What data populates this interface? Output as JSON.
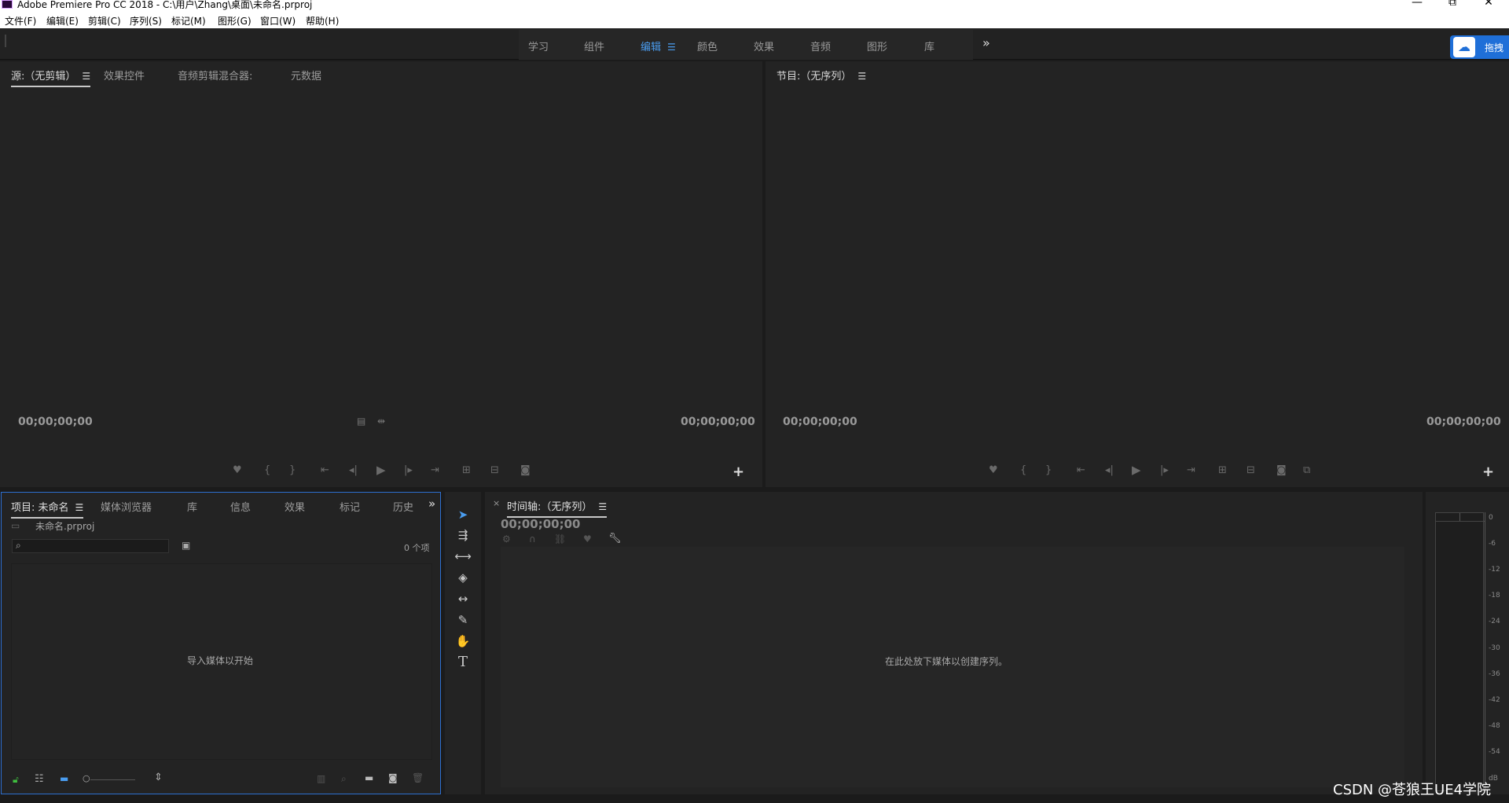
{
  "window": {
    "title": "Adobe Premiere Pro CC 2018 - C:\\用户\\Zhang\\桌面\\未命名.prproj",
    "minimize": "—",
    "maximize": "⧉",
    "close": "✕"
  },
  "menu": [
    "文件(F)",
    "编辑(E)",
    "剪辑(C)",
    "序列(S)",
    "标记(M)",
    "图形(G)",
    "窗口(W)",
    "帮助(H)"
  ],
  "workspaces": {
    "items": [
      "学习",
      "组件",
      "编辑",
      "颜色",
      "效果",
      "音频",
      "图形",
      "库"
    ],
    "active": "编辑",
    "more": "»"
  },
  "baidu": {
    "label": "拖拽"
  },
  "source_panel": {
    "tabs": [
      "源:（无剪辑）",
      "效果控件",
      "音频剪辑混合器:",
      "元数据"
    ],
    "timecode_left": "00;00;00;00",
    "timecode_right": "00;00;00;00",
    "add_label": "+"
  },
  "program_panel": {
    "tabs": [
      "节目:（无序列）"
    ],
    "timecode_left": "00;00;00;00",
    "timecode_right": "00;00;00;00",
    "add_label": "+"
  },
  "project_panel": {
    "tabs": [
      "项目: 未命名",
      "媒体浏览器",
      "库",
      "信息",
      "效果",
      "标记",
      "历史"
    ],
    "file_name": "未命名.prproj",
    "search_placeholder": "",
    "item_count": "0 个项",
    "empty_message": "导入媒体以开始",
    "more": "»"
  },
  "timeline_panel": {
    "close": "×",
    "title": "时间轴:（无序列）",
    "timecode": "00;00;00;00",
    "empty_message": "在此处放下媒体以创建序列。"
  },
  "audio_meter": {
    "ticks": [
      "0",
      "-6",
      "-12",
      "-18",
      "-24",
      "-30",
      "-36",
      "-42",
      "-48",
      "-54",
      "dB"
    ]
  },
  "watermark": "CSDN @苍狼王UE4学院",
  "colors": {
    "accent": "#4a9df0",
    "panel_bg": "#232323",
    "app_bg": "#1b1b1b",
    "focus_border": "#2d6fd0"
  }
}
